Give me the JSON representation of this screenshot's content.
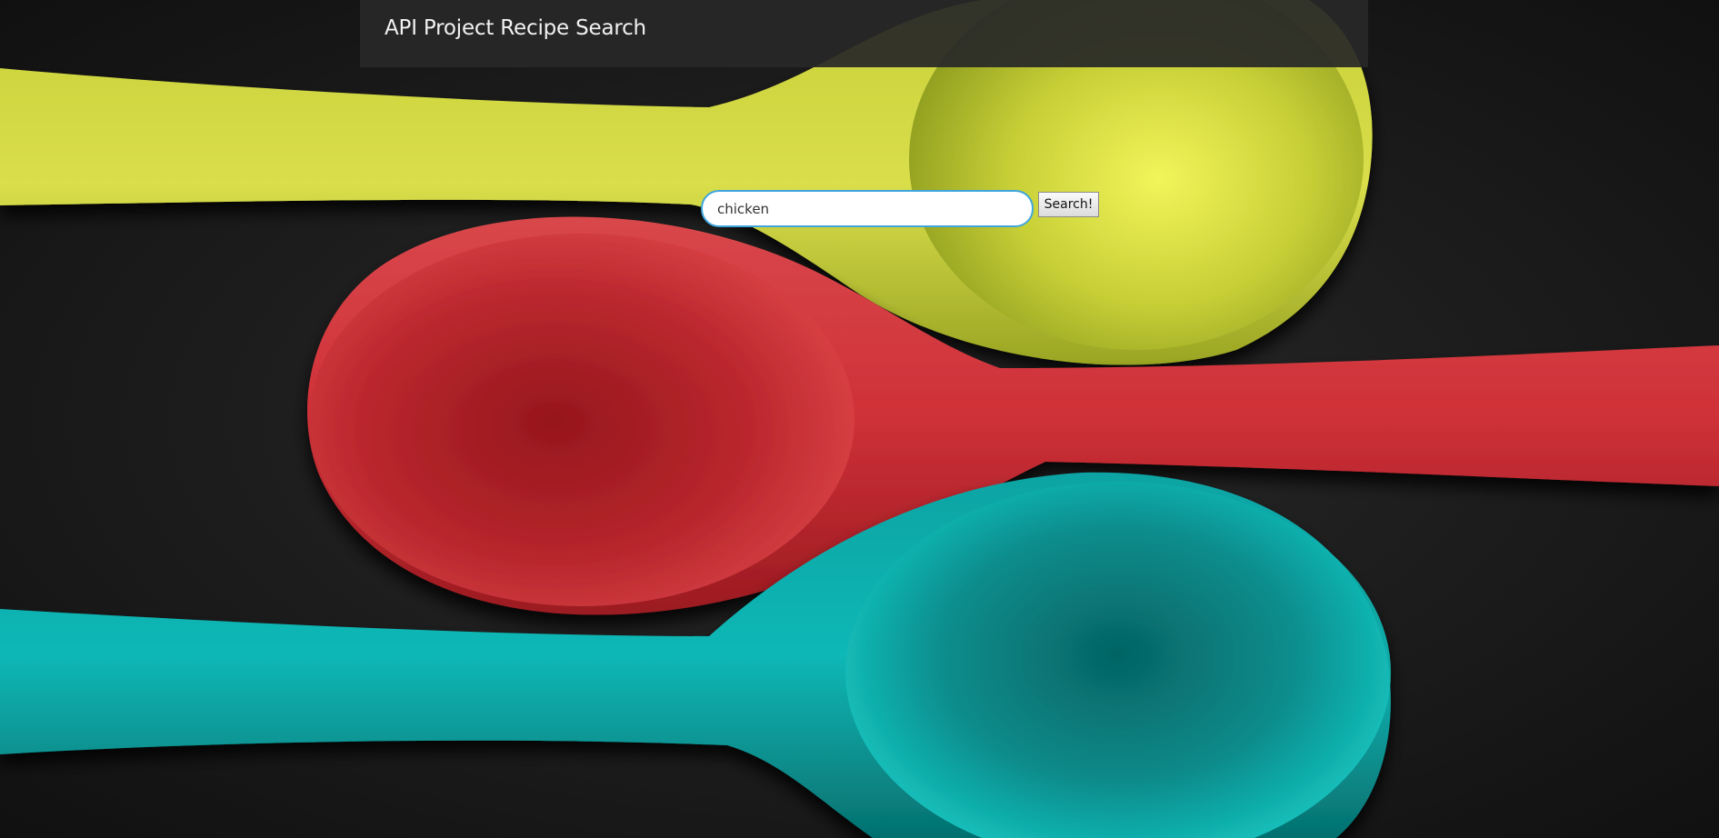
{
  "navbar": {
    "title": "API Project Recipe Search"
  },
  "search": {
    "value": "chicken",
    "placeholder": "",
    "button_label": "Search!"
  },
  "background": {
    "base_color": "#151515",
    "spoon_colors": [
      "#d6dc3c",
      "#d2353c",
      "#00b4b4"
    ]
  }
}
